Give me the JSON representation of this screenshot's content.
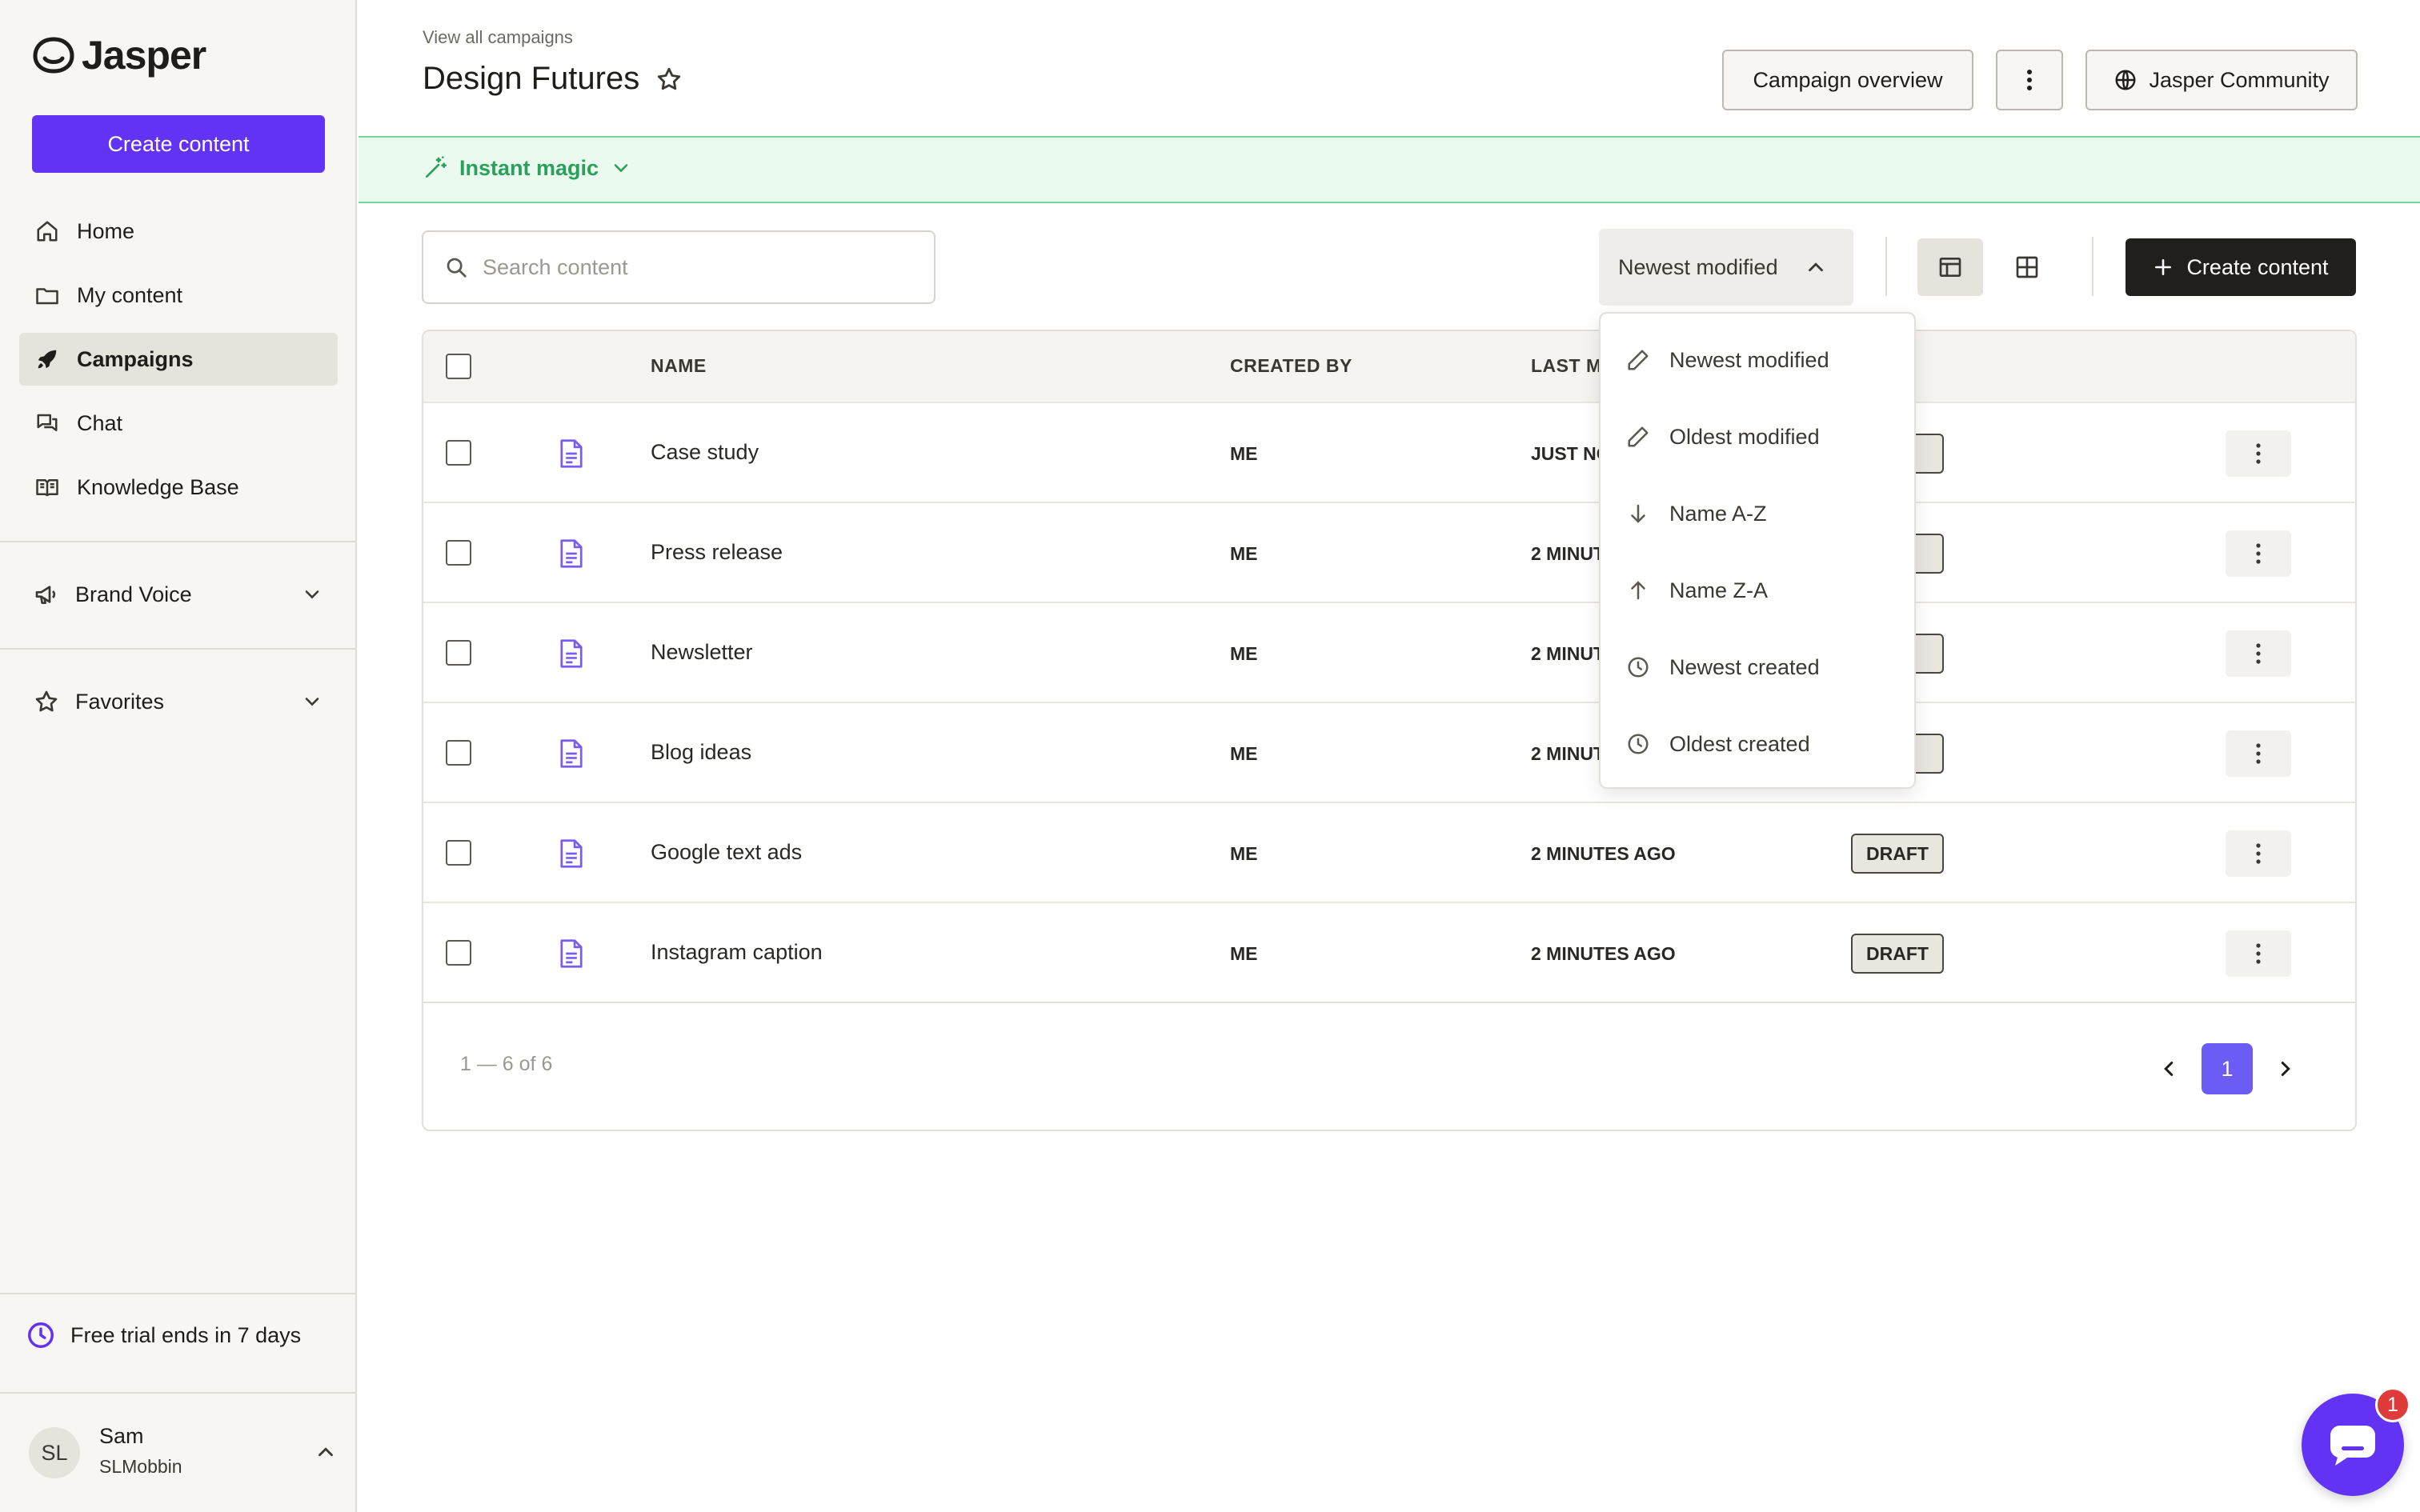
{
  "app": {
    "name": "Jasper"
  },
  "sidebar": {
    "create_label": "Create content",
    "nav": [
      {
        "label": "Home",
        "icon": "home-icon"
      },
      {
        "label": "My content",
        "icon": "folder-icon"
      },
      {
        "label": "Campaigns",
        "icon": "rocket-icon",
        "active": true
      },
      {
        "label": "Chat",
        "icon": "chat-icon"
      },
      {
        "label": "Knowledge Base",
        "icon": "book-icon"
      }
    ],
    "groups": [
      {
        "label": "Brand Voice",
        "icon": "megaphone-icon"
      },
      {
        "label": "Favorites",
        "icon": "star-icon"
      }
    ],
    "trial_text": "Free trial ends in 7 days",
    "user": {
      "initials": "SL",
      "name": "Sam",
      "handle": "SLMobbin"
    }
  },
  "header": {
    "breadcrumb": "View all campaigns",
    "title": "Design Futures",
    "overview_label": "Campaign overview",
    "community_label": "Jasper Community"
  },
  "magic": {
    "label": "Instant magic"
  },
  "toolbar": {
    "search_placeholder": "Search content",
    "sort_label": "Newest modified",
    "create_label": "Create content"
  },
  "table": {
    "columns": {
      "name": "NAME",
      "created_by": "CREATED BY",
      "last_modified": "LAST M"
    },
    "rows": [
      {
        "name": "Case study",
        "created_by": "ME",
        "modified": "JUST NO",
        "status": "T"
      },
      {
        "name": "Press release",
        "created_by": "ME",
        "modified": "2 MINUT",
        "status": "T"
      },
      {
        "name": "Newsletter",
        "created_by": "ME",
        "modified": "2 MINUT",
        "status": "T"
      },
      {
        "name": "Blog ideas",
        "created_by": "ME",
        "modified": "2 MINUT",
        "status": "T"
      },
      {
        "name": "Google text ads",
        "created_by": "ME",
        "modified": "2 MINUTES AGO",
        "status": "DRAFT"
      },
      {
        "name": "Instagram caption",
        "created_by": "ME",
        "modified": "2 MINUTES AGO",
        "status": "DRAFT"
      }
    ],
    "range_text": "1 — 6 of 6",
    "current_page": "1"
  },
  "sort_menu": {
    "items": [
      {
        "label": "Newest modified",
        "icon": "pencil-icon"
      },
      {
        "label": "Oldest modified",
        "icon": "pencil-icon"
      },
      {
        "label": "Name A-Z",
        "icon": "arrow-down-icon"
      },
      {
        "label": "Name Z-A",
        "icon": "arrow-up-icon"
      },
      {
        "label": "Newest created",
        "icon": "clock-icon"
      },
      {
        "label": "Oldest created",
        "icon": "clock-icon"
      }
    ]
  },
  "chat_widget": {
    "badge_count": "1"
  },
  "colors": {
    "brand_purple": "#6333f5",
    "magic_green": "#2aa05a",
    "pager_active": "#6b5cf6",
    "doc_icon": "#7b5cf0"
  }
}
